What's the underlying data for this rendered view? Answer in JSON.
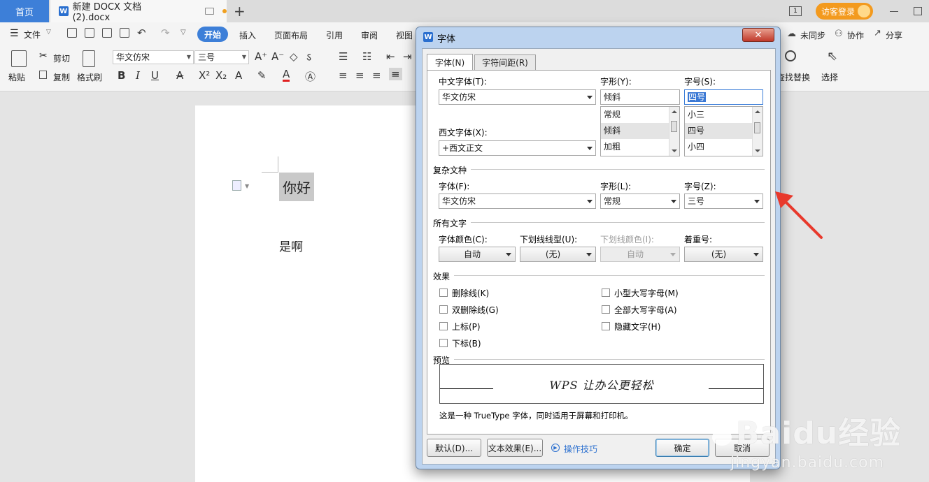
{
  "tabbar": {
    "home": "首页",
    "doc_icon": "W",
    "doc_title": "新建 DOCX 文档 (2).docx",
    "new_tab": "+",
    "page_indicator": "1",
    "login": "访客登录"
  },
  "menu": {
    "file": "文件",
    "items": [
      "开始",
      "插入",
      "页面布局",
      "引用",
      "审阅",
      "视图"
    ],
    "right": [
      "未同步",
      "协作",
      "分享"
    ]
  },
  "ribbon": {
    "paste": "粘贴",
    "cut": "剪切",
    "copy": "复制",
    "format_painter": "格式刷",
    "font_name": "华文仿宋",
    "font_size": "三号",
    "find_replace": "查找替换",
    "select": "选择"
  },
  "document": {
    "line1": "你好",
    "line2": "是啊"
  },
  "dialog": {
    "icon": "W",
    "title": "字体",
    "tabs": [
      "字体(N)",
      "字符间距(R)"
    ],
    "cn_font_label": "中文字体(T):",
    "cn_font_value": "华文仿宋",
    "style_label": "字形(Y):",
    "style_value": "倾斜",
    "style_options": [
      "常规",
      "倾斜",
      "加粗"
    ],
    "size_label": "字号(S):",
    "size_value": "四号",
    "size_options": [
      "小三",
      "四号",
      "小四"
    ],
    "west_font_label": "西文字体(X):",
    "west_font_value": "+西文正文",
    "complex_section": "复杂文种",
    "complex_font_label": "字体(F):",
    "complex_font_value": "华文仿宋",
    "complex_style_label": "字形(L):",
    "complex_style_value": "常规",
    "complex_size_label": "字号(Z):",
    "complex_size_value": "三号",
    "all_text_section": "所有文字",
    "color_label": "字体颜色(C):",
    "color_value": "自动",
    "underline_label": "下划线线型(U):",
    "underline_value": "(无)",
    "underline_color_label": "下划线颜色(I):",
    "underline_color_value": "自动",
    "emphasis_label": "着重号:",
    "emphasis_value": "(无)",
    "effects_section": "效果",
    "effects_left": [
      "删除线(K)",
      "双删除线(G)",
      "上标(P)",
      "下标(B)"
    ],
    "effects_right": [
      "小型大写字母(M)",
      "全部大写字母(A)",
      "隐藏文字(H)"
    ],
    "preview_section": "预览",
    "preview_text": "WPS 让办公更轻松",
    "preview_note": "这是一种 TrueType 字体，同时适用于屏幕和打印机。",
    "btn_default": "默认(D)...",
    "btn_text_effect": "文本效果(E)...",
    "tips": "操作技巧",
    "btn_ok": "确定",
    "btn_cancel": "取消"
  },
  "watermark": {
    "brand": "Baidu经验",
    "url": "jingyan.baidu.com"
  },
  "colors": {
    "accent": "#3d7fd8",
    "login": "#f39a1e",
    "arrow": "#e8392c"
  }
}
